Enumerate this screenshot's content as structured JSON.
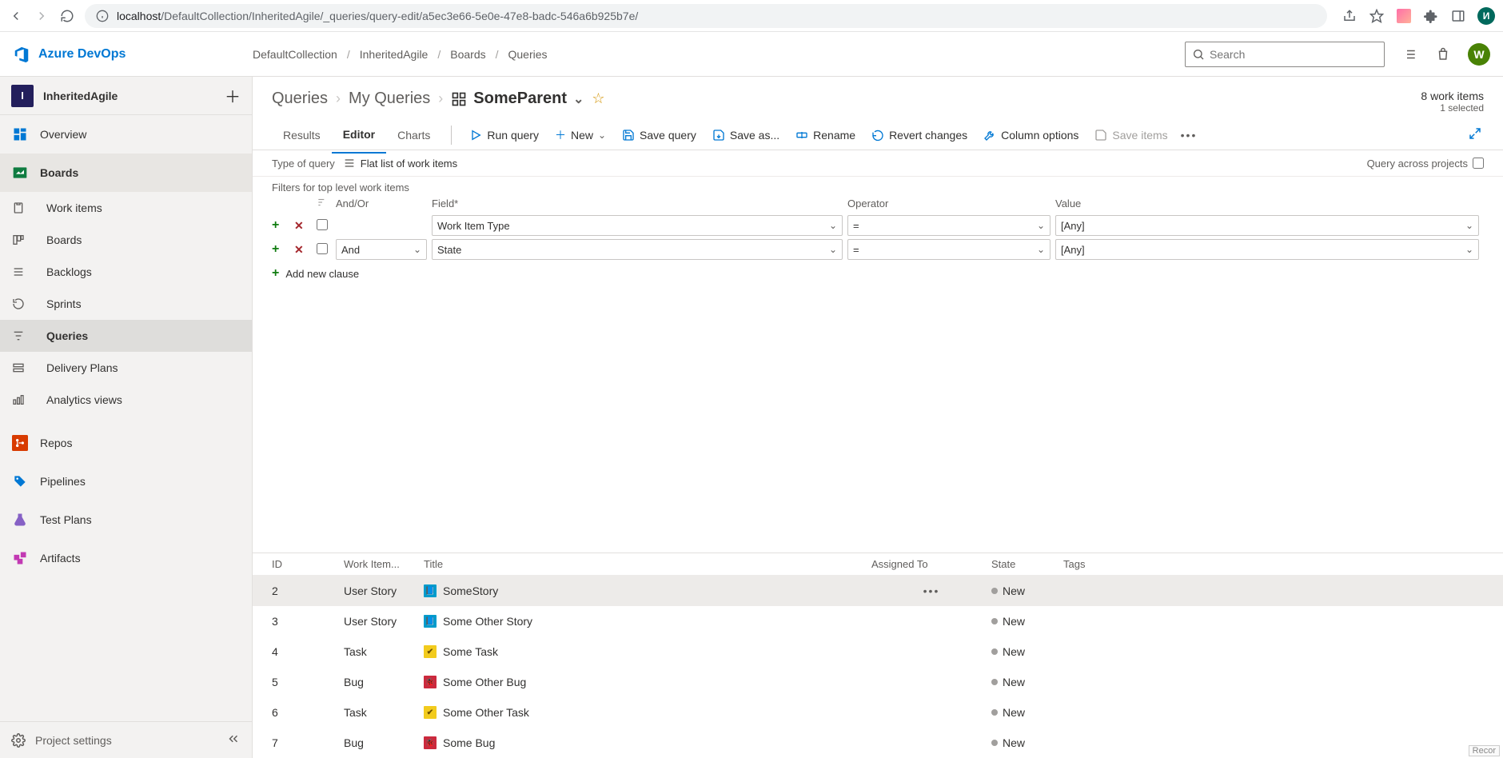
{
  "browser": {
    "url_host": "localhost",
    "url_path": "/DefaultCollection/InheritedAgile/_queries/query-edit/a5ec3e66-5e0e-47e8-badc-546a6b925b7e/",
    "avatar_letter": "И"
  },
  "suite": {
    "product": "Azure DevOps",
    "breadcrumb": [
      "DefaultCollection",
      "InheritedAgile",
      "Boards",
      "Queries"
    ],
    "search_placeholder": "Search",
    "avatar_letter": "W"
  },
  "sidebar": {
    "project_initial": "I",
    "project_name": "InheritedAgile",
    "items": [
      {
        "icon": "overview",
        "label": "Overview",
        "accent": "#0078d4"
      },
      {
        "icon": "boards",
        "label": "Boards",
        "accent": "#107c41",
        "active": true,
        "children": [
          {
            "icon": "workitems",
            "label": "Work items"
          },
          {
            "icon": "boards-sub",
            "label": "Boards"
          },
          {
            "icon": "backlogs",
            "label": "Backlogs"
          },
          {
            "icon": "sprints",
            "label": "Sprints"
          },
          {
            "icon": "queries",
            "label": "Queries",
            "active": true
          },
          {
            "icon": "delivery",
            "label": "Delivery Plans"
          },
          {
            "icon": "analytics",
            "label": "Analytics views"
          }
        ]
      },
      {
        "icon": "repos",
        "label": "Repos",
        "accent": "#d83b01"
      },
      {
        "icon": "pipelines",
        "label": "Pipelines",
        "accent": "#0078d4"
      },
      {
        "icon": "testplans",
        "label": "Test Plans",
        "accent": "#8661c5"
      },
      {
        "icon": "artifacts",
        "label": "Artifacts",
        "accent": "#c239b3"
      }
    ],
    "footer": "Project settings"
  },
  "page": {
    "crumb": {
      "root": "Queries",
      "parent": "My Queries",
      "current": "SomeParent"
    },
    "count": "8 work items",
    "selected": "1 selected",
    "tabs": [
      "Results",
      "Editor",
      "Charts"
    ],
    "active_tab": 1,
    "commands": {
      "run": "Run query",
      "new": "New",
      "save": "Save query",
      "saveas": "Save as...",
      "rename": "Rename",
      "revert": "Revert changes",
      "columns": "Column options",
      "saveitems": "Save items"
    },
    "query_type": {
      "label": "Type of query",
      "value": "Flat list of work items"
    },
    "query_across": "Query across projects"
  },
  "filters": {
    "heading": "Filters for top level work items",
    "headers": {
      "andor": "And/Or",
      "field": "Field*",
      "operator": "Operator",
      "value": "Value"
    },
    "rows": [
      {
        "andor": "",
        "field": "Work Item Type",
        "operator": "=",
        "value": "[Any]"
      },
      {
        "andor": "And",
        "field": "State",
        "operator": "=",
        "value": "[Any]"
      }
    ],
    "add_clause": "Add new clause"
  },
  "results": {
    "headers": {
      "id": "ID",
      "type": "Work Item...",
      "title": "Title",
      "assigned": "Assigned To",
      "state": "State",
      "tags": "Tags"
    },
    "rows": [
      {
        "id": "2",
        "type": "User Story",
        "title": "SomeStory",
        "state": "New",
        "type_color": "#009ccc",
        "selected": true
      },
      {
        "id": "3",
        "type": "User Story",
        "title": "Some Other Story",
        "state": "New",
        "type_color": "#009ccc"
      },
      {
        "id": "4",
        "type": "Task",
        "title": "Some Task",
        "state": "New",
        "type_color": "#f2cb1d"
      },
      {
        "id": "5",
        "type": "Bug",
        "title": "Some Other Bug",
        "state": "New",
        "type_color": "#cc293d"
      },
      {
        "id": "6",
        "type": "Task",
        "title": "Some Other Task",
        "state": "New",
        "type_color": "#f2cb1d"
      },
      {
        "id": "7",
        "type": "Bug",
        "title": "Some Bug",
        "state": "New",
        "type_color": "#cc293d"
      }
    ]
  },
  "rec_label": "Recor"
}
